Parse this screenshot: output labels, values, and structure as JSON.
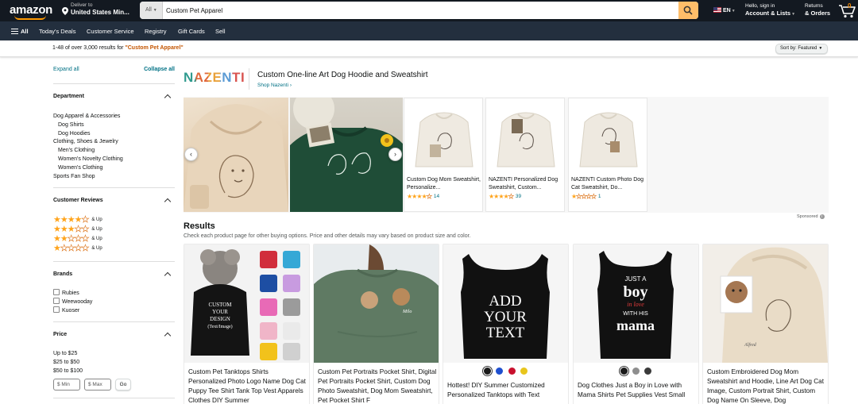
{
  "nav": {
    "logo": "amazon",
    "deliver_label": "Deliver to",
    "deliver_location": "United States Min...",
    "search_category": "All",
    "search_value": "Custom Pet Apparel",
    "language": "EN",
    "account_line1": "Hello, sign in",
    "account_line2": "Account & Lists",
    "returns_line1": "Returns",
    "returns_line2": "& Orders",
    "cart_count": "0",
    "accent_color": "#febd69"
  },
  "subnav": {
    "all": "All",
    "items": [
      "Today's Deals",
      "Customer Service",
      "Registry",
      "Gift Cards",
      "Sell"
    ]
  },
  "results_bar": {
    "prefix": "1-48 of over 3,000 results for ",
    "query": "\"Custom Pet Apparel\"",
    "sort": "Sort by:  Featured"
  },
  "sidebar": {
    "expand_all": "Expand all",
    "collapse_all": "Collapse all",
    "department": {
      "title": "Department",
      "items": [
        "Dog Apparel & Accessories",
        "Dog Shirts",
        "Dog Hoodies",
        "Clothing, Shoes & Jewelry",
        "Men's Clothing",
        "Women's Novelty Clothing",
        "Women's Clothing",
        "Sports Fan Shop"
      ]
    },
    "reviews": {
      "title": "Customer Reviews",
      "up": "& Up",
      "levels": [
        4,
        3,
        2,
        1
      ]
    },
    "brands": {
      "title": "Brands",
      "items": [
        "Rubies",
        "Weewooday",
        "Kuoser"
      ]
    },
    "price": {
      "title": "Price",
      "ranges": [
        "Up to $25",
        "$25 to $50",
        "$50 to $100"
      ],
      "min_placeholder": "$ Min",
      "max_placeholder": "$ Max",
      "go": "Go"
    }
  },
  "banner": {
    "brand": "NAZENTI",
    "title": "Custom One-line Art Dog Hoodie and Sweatshirt",
    "shop_link": "Shop Nazenti ›",
    "sponsored": "Sponsored",
    "products": [
      {
        "name": "Custom Dog Mom Sweatshirt, Personalize...",
        "rating": 4.5,
        "reviews": "14"
      },
      {
        "name": "NAZENTI Personalized Dog Sweatshirt, Custom...",
        "rating": 4.5,
        "reviews": "39"
      },
      {
        "name": "NAZENTI Custom Photo Dog Cat Sweatshirt, Do...",
        "rating": 1,
        "reviews": "1"
      }
    ]
  },
  "results": {
    "title": "Results",
    "subtitle": "Check each product page for other buying options. Price and other details may vary based on product size and color.",
    "items": [
      {
        "title": "Custom Pet Tanktops Shirts Personalized Photo Logo Name Dog Cat Puppy Tee Shirt Tank Top Vest Apparels Clothes DIY Summer",
        "image_text": "CUSTOM YOUR DESIGN (Text/Image)"
      },
      {
        "title": "Custom Pet Portraits Pocket Shirt, Digital Pet Portraits Pocket Shirt, Custom Dog Photo Sweatshirt, Dog Mom Sweatshirt, Pet Pocket Shirt F",
        "image_text": "Milo"
      },
      {
        "title": "Hottest! DIY Summer Customized Personalized Tanktops with Text",
        "image_text": "ADD YOUR TEXT",
        "swatches": [
          "#1a1a1a",
          "#1e4fcf",
          "#c8102e",
          "#e8c51c"
        ]
      },
      {
        "title": "Dog Clothes Just a Boy in Love with Mama Shirts Pet Supplies Vest Small",
        "image_text": "JUST A boy in love WITH HIS mama",
        "swatches": [
          "#1a1a1a",
          "#8e8e8e",
          "#3a3a3a"
        ]
      },
      {
        "title": "Custom Embroidered Dog Mom Sweatshirt and Hoodie, Line Art Dog Cat Image, Custom Portrait Shirt, Custom Dog Name On Sleeve, Dog",
        "image_text": "Alfred"
      }
    ]
  }
}
